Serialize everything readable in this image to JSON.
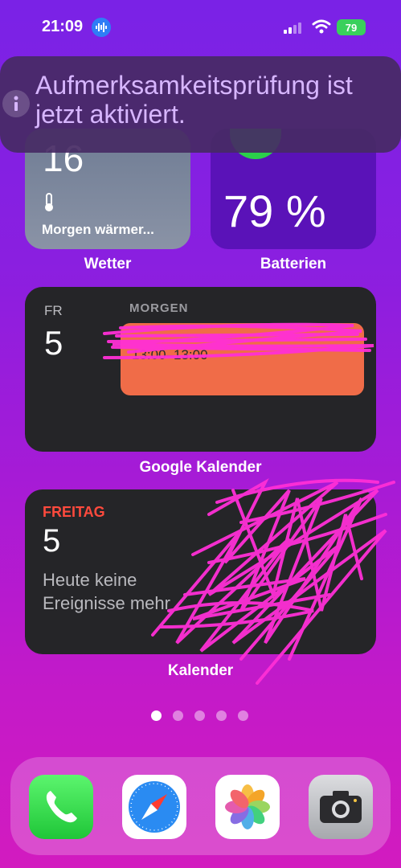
{
  "status_bar": {
    "time": "21:09",
    "battery": "79"
  },
  "banner": {
    "text": "Aufmerksamkeitsprüfung ist jetzt aktiviert."
  },
  "weather_widget": {
    "temp": "16",
    "forecast": "Morgen wärmer...",
    "label": "Wetter"
  },
  "battery_widget": {
    "percent": "79 %",
    "label": "Batterien"
  },
  "google_calendar_widget": {
    "day_of_week": "FR",
    "day": "5",
    "section": "MORGEN",
    "event_time": "13:00–13:00",
    "label": "Google Kalender",
    "event_color": "#f06c48"
  },
  "calendar_widget": {
    "day_of_week": "FREITAG",
    "day": "5",
    "no_events": "Heute keine Ereignisse mehr",
    "label": "Kalender"
  },
  "page_indicator": {
    "count": 5,
    "active_index": 0
  },
  "dock": {
    "apps": [
      {
        "name": "phone-icon"
      },
      {
        "name": "safari-icon"
      },
      {
        "name": "photos-icon"
      },
      {
        "name": "camera-icon"
      }
    ]
  },
  "colors": {
    "accent_red": "#ff4a3d",
    "battery_green": "#39d05c"
  }
}
